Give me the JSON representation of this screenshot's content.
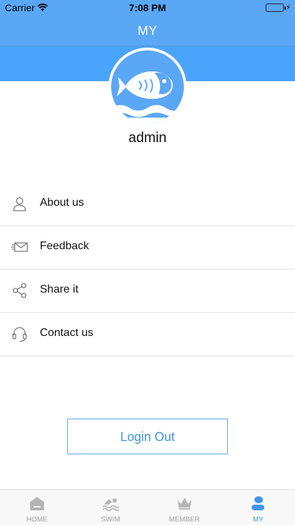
{
  "status_bar": {
    "carrier": "Carrier",
    "time": "7:08 PM"
  },
  "nav": {
    "title": "MY"
  },
  "profile": {
    "username": "admin"
  },
  "menu": [
    {
      "label": "About us",
      "icon": "user-icon"
    },
    {
      "label": "Feedback",
      "icon": "mail-icon"
    },
    {
      "label": "Share it",
      "icon": "share-icon"
    },
    {
      "label": "Contact us",
      "icon": "headset-icon"
    }
  ],
  "logout": {
    "label": "Login Out"
  },
  "tabs": [
    {
      "label": "HOME",
      "icon": "home-icon",
      "active": false
    },
    {
      "label": "SWIM",
      "icon": "swim-icon",
      "active": false
    },
    {
      "label": "MEMBER",
      "icon": "crown-icon",
      "active": false
    },
    {
      "label": "MY",
      "icon": "person-icon",
      "active": true
    }
  ],
  "colors": {
    "primary": "#5aa7f5",
    "accent": "#3f95e8",
    "inactive": "#9a9a9a"
  }
}
